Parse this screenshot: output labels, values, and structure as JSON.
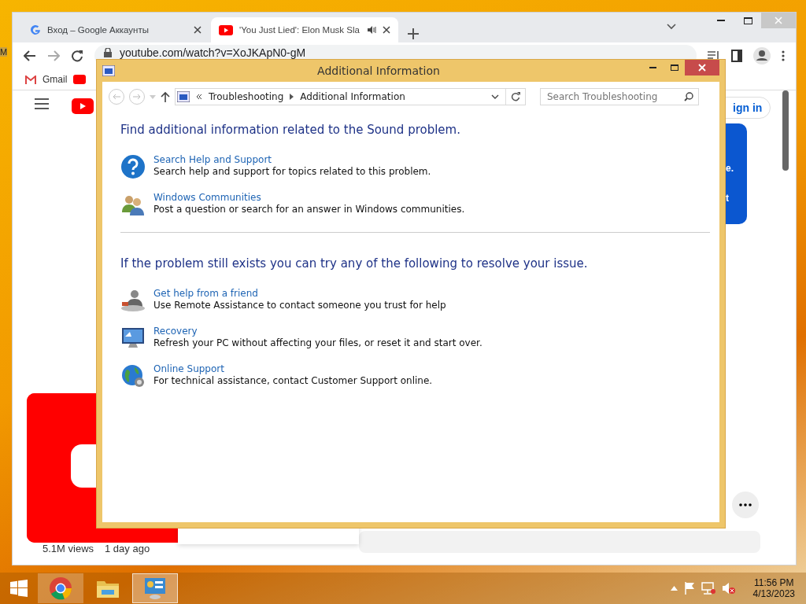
{
  "desktop": {
    "icon_label": "M"
  },
  "browser": {
    "tabs": [
      {
        "title": "Вход – Google Аккаунты",
        "selected": false,
        "audio": false
      },
      {
        "title": "'You Just Lied': Elon Musk Sla",
        "selected": true,
        "audio": true
      }
    ],
    "url": "youtube.com/watch?v=XoJKApN0-gM",
    "bookmarks": [
      {
        "label": "Gmail"
      }
    ],
    "page": {
      "sign_in": "ign in",
      "popup_lines": [
        "e.",
        "t"
      ],
      "views": "5.1M views",
      "age": "1 day ago"
    }
  },
  "dialog": {
    "title": "Additional Information",
    "breadcrumb": [
      "Troubleshooting",
      "Additional Information"
    ],
    "search": {
      "placeholder": "Search Troubleshooting"
    },
    "sections": [
      {
        "heading": "Find additional information related to the Sound problem.",
        "items": [
          {
            "kind": "help",
            "title": "Search Help and Support",
            "description": "Search help and support for topics related to this problem."
          },
          {
            "kind": "community",
            "title": "Windows Communities",
            "description": "Post a question or search for an answer in Windows communities."
          }
        ]
      },
      {
        "heading": "If the problem still exists you can try any of the following to resolve your issue.",
        "items": [
          {
            "kind": "friend",
            "title": "Get help from a friend",
            "description": "Use Remote Assistance to contact someone you trust for help"
          },
          {
            "kind": "recovery",
            "title": "Recovery",
            "description": "Refresh your PC without affecting your files, or reset it and start over."
          },
          {
            "kind": "globe",
            "title": "Online Support",
            "description": "For technical assistance, contact Customer Support online."
          }
        ]
      }
    ]
  },
  "taskbar": {
    "apps": [
      {
        "kind": "chrome",
        "selected": false
      },
      {
        "kind": "explorer",
        "selected": false
      },
      {
        "kind": "control-panel",
        "selected": true
      }
    ],
    "time": "11:56 PM",
    "date": "4/13/2023"
  }
}
